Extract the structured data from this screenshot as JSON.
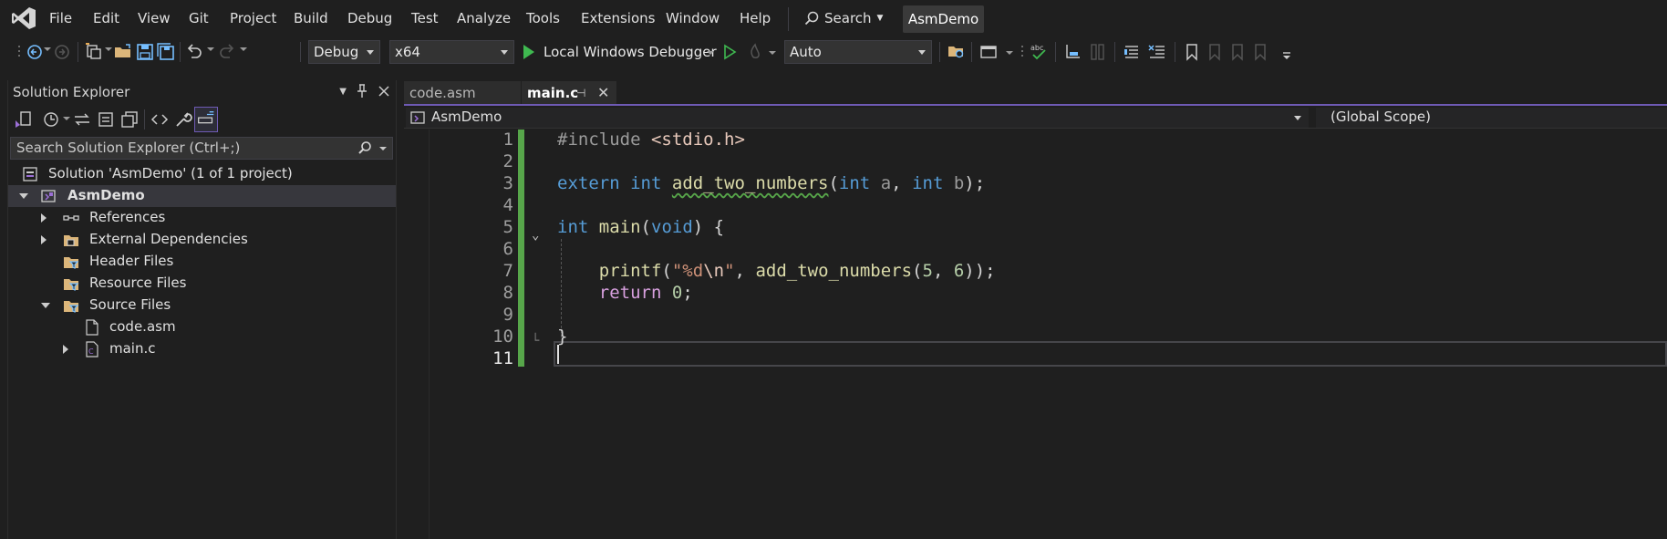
{
  "menubar": {
    "items": [
      "File",
      "Edit",
      "View",
      "Git",
      "Project",
      "Build",
      "Debug",
      "Test",
      "Analyze",
      "Tools",
      "Extensions",
      "Window",
      "Help"
    ],
    "search_label": "Search",
    "project_badge": "AsmDemo"
  },
  "toolbar": {
    "configuration": "Debug",
    "platform": "x64",
    "debugger_label": "Local Windows Debugger",
    "auto_combo": "Auto",
    "colors": {
      "play": "#3fb950",
      "accent": "#6e5ab4"
    }
  },
  "solution_explorer": {
    "title": "Solution Explorer",
    "search_placeholder": "Search Solution Explorer (Ctrl+;)",
    "tree": [
      {
        "label": "Solution 'AsmDemo' (1 of 1 project)",
        "icon": "solution-icon",
        "expander": "none"
      },
      {
        "label": "AsmDemo",
        "icon": "project-icon",
        "expander": "open",
        "selected": true,
        "bold": true
      },
      {
        "label": "References",
        "icon": "references-icon",
        "expander": "closed"
      },
      {
        "label": "External Dependencies",
        "icon": "external-deps-icon",
        "expander": "closed"
      },
      {
        "label": "Header Files",
        "icon": "filter-folder-icon",
        "expander": "none"
      },
      {
        "label": "Resource Files",
        "icon": "filter-folder-icon",
        "expander": "none"
      },
      {
        "label": "Source Files",
        "icon": "filter-folder-icon",
        "expander": "open"
      },
      {
        "label": "code.asm",
        "icon": "file-icon",
        "expander": "none"
      },
      {
        "label": "main.c",
        "icon": "c-file-icon",
        "expander": "closed"
      }
    ]
  },
  "editor": {
    "tabs": [
      {
        "label": "code.asm",
        "active": false
      },
      {
        "label": "main.c",
        "active": true
      }
    ],
    "nav_project": "AsmDemo",
    "nav_scope": "(Global Scope)",
    "line_numbers": [
      "1",
      "2",
      "3",
      "4",
      "5",
      "6",
      "7",
      "8",
      "9",
      "10",
      "11"
    ],
    "current_line": "11",
    "code": {
      "l1_directive": "#include",
      "l1_header": "<stdio.h>",
      "l3_extern": "extern",
      "l3_int": "int",
      "l3_fn": "add_two_numbers",
      "l3_paren": "(",
      "l3_int_a": "int",
      "l3_a": "a",
      "l3_comma": ",",
      "l3_int_b": "int",
      "l3_b": "b",
      "l3_close": ");",
      "l5_int": "int",
      "l5_main": "main",
      "l5_open": "(",
      "l5_void": "void",
      "l5_close": ") {",
      "l7_printf": "printf",
      "l7_open": "(",
      "l7_str_a": "\"%d",
      "l7_esc": "\\n",
      "l7_str_b": "\"",
      "l7_comma": ",",
      "l7_fn": "add_two_numbers",
      "l7_paren": "(",
      "l7_n1": "5",
      "l7_comma2": ",",
      "l7_n2": "6",
      "l7_end": "));",
      "l8_return": "return",
      "l8_zero": "0",
      "l8_semi": ";",
      "l10_brace": "}"
    }
  }
}
